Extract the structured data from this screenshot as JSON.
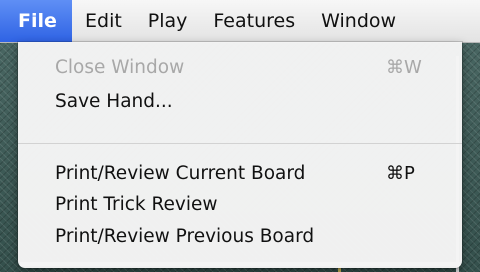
{
  "menubar": {
    "items": [
      {
        "label": "File",
        "active": true
      },
      {
        "label": "Edit",
        "active": false
      },
      {
        "label": "Play",
        "active": false
      },
      {
        "label": "Features",
        "active": false
      },
      {
        "label": "Window",
        "active": false
      }
    ]
  },
  "file_menu": {
    "items": [
      {
        "label": "Close Window",
        "shortcut": "⌘W",
        "enabled": false
      },
      {
        "label": "Save Hand...",
        "shortcut": "",
        "enabled": true
      },
      {
        "label": "Print/Review Current Board",
        "shortcut": "⌘P",
        "enabled": true
      },
      {
        "label": "Print Trick Review",
        "shortcut": "",
        "enabled": true
      },
      {
        "label": "Print/Review Previous Board",
        "shortcut": "",
        "enabled": true
      }
    ]
  },
  "colors": {
    "highlight": "#2f63e4",
    "menu_background": "#f4f4f4",
    "disabled_text": "#a8a8a8"
  }
}
